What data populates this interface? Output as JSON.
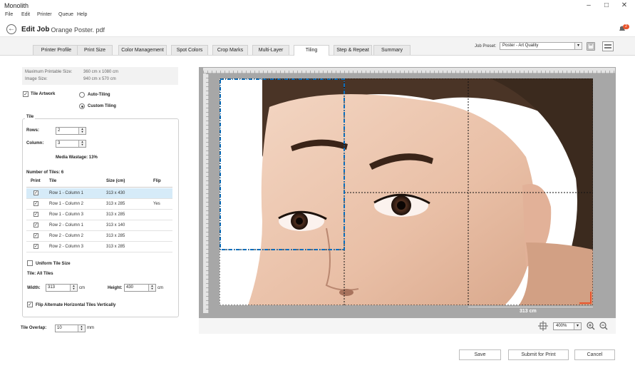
{
  "app": {
    "title": "Monolith"
  },
  "menu": [
    "File",
    "Edit",
    "Printer",
    "Queue",
    "Help"
  ],
  "header": {
    "title": "Edit Job",
    "subtitle": "- Orange Poster. pdf",
    "notification_count": "2"
  },
  "tabs": [
    "Printer Profile",
    "Print Size",
    "Color Management",
    "Spot Colors",
    "Crop Marks",
    "Multi-Layer",
    "Tiling",
    "Step & Repeat",
    "Summary"
  ],
  "active_tab": "Tiling",
  "job_preset": {
    "label": "Job Preset:",
    "value": "Poster - Art Quality"
  },
  "info": {
    "max_label": "Maximum Printable Size:",
    "max_value": "360 cm x 1080 cm",
    "image_label": "Image Size:",
    "image_value": "940 cm x 570 cm"
  },
  "tile_artwork": {
    "label": "Tile Artwork",
    "checked": true
  },
  "tiling_mode": {
    "auto": "Auto-Tiling",
    "custom": "Custom Tiling",
    "selected": "custom"
  },
  "tile": {
    "group_label": "Tile",
    "rows_label": "Rows:",
    "rows": "2",
    "columns_label": "Column:",
    "columns": "3",
    "wastage": "Media Wastage: 13%",
    "count": "Number of Tiles: 6",
    "table": {
      "headers": [
        "Print",
        "Tile",
        "Size (cm)",
        "Flip"
      ],
      "rows": [
        {
          "tile": "Row 1 - Column 1",
          "size": "313 x 430",
          "flip": ""
        },
        {
          "tile": "Row 1 - Column 2",
          "size": "313 x 285",
          "flip": "Yes"
        },
        {
          "tile": "Row 1 - Column 3",
          "size": "313 x 285",
          "flip": ""
        },
        {
          "tile": "Row 2 - Column 1",
          "size": "313 x 140",
          "flip": ""
        },
        {
          "tile": "Row 2 - Column 2",
          "size": "313 x 285",
          "flip": ""
        },
        {
          "tile": "Row 2 - Column 3",
          "size": "313 x 285",
          "flip": ""
        }
      ]
    },
    "uniform_label": "Uniform Tile Size",
    "tile_all": "Tile:  All Tiles",
    "width_label": "Width:",
    "width": "313",
    "width_unit": "cm",
    "height_label": "Height:",
    "height": "430",
    "height_unit": "cm",
    "flip_label": "Flip Alternate Horizontal Tiles Vertically"
  },
  "overlap": {
    "label": "Tile Overlap:",
    "value": "10",
    "unit": "mm"
  },
  "canvas": {
    "dimension_label": "313 cm",
    "zoom": "400%"
  },
  "footer": {
    "save": "Save",
    "submit": "Submit for Print",
    "cancel": "Cancel"
  },
  "colors": {
    "accent": "#0a6ebd",
    "selected_row": "#d6ebf8",
    "notification": "#e8542c",
    "corner_marker": "#e8542c"
  }
}
